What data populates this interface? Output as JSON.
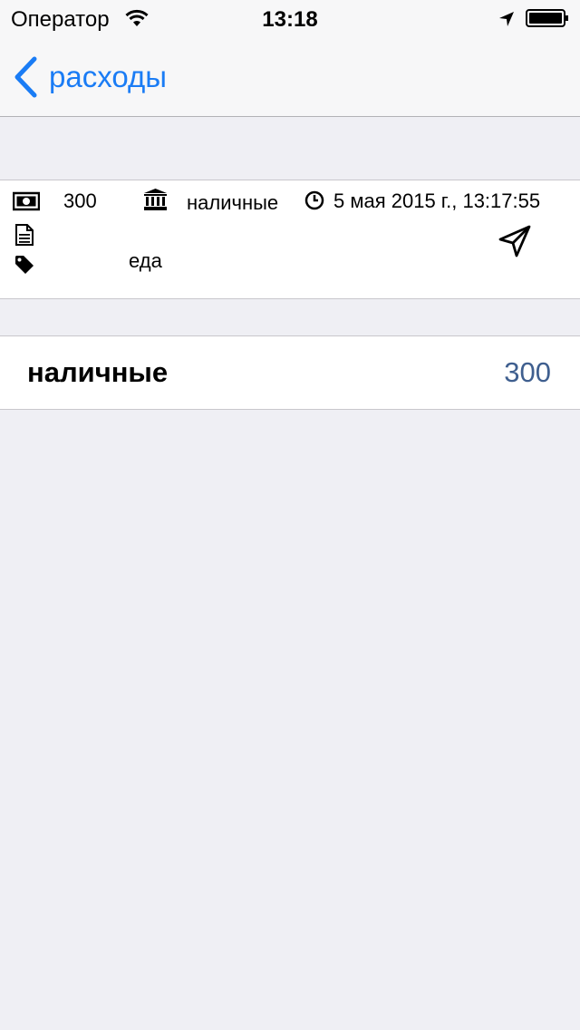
{
  "status_bar": {
    "carrier": "Оператор",
    "time": "13:18",
    "icons": [
      "wifi-icon",
      "location-arrow-icon",
      "battery-icon"
    ]
  },
  "nav": {
    "back_label": "расходы",
    "accent_color": "#1a7cf5"
  },
  "entry": {
    "amount": "300",
    "account": "наличные",
    "datetime": "5 мая 2015 г., 13:17:55",
    "note": "",
    "category": "еда",
    "icons": [
      "money-icon",
      "bank-icon",
      "clock-icon",
      "document-icon",
      "tag-icon",
      "send-icon"
    ]
  },
  "accounts": [
    {
      "name": "наличные",
      "amount": "300"
    }
  ],
  "colors": {
    "background": "#efeff4",
    "amount_color": "#3f5f8f"
  }
}
